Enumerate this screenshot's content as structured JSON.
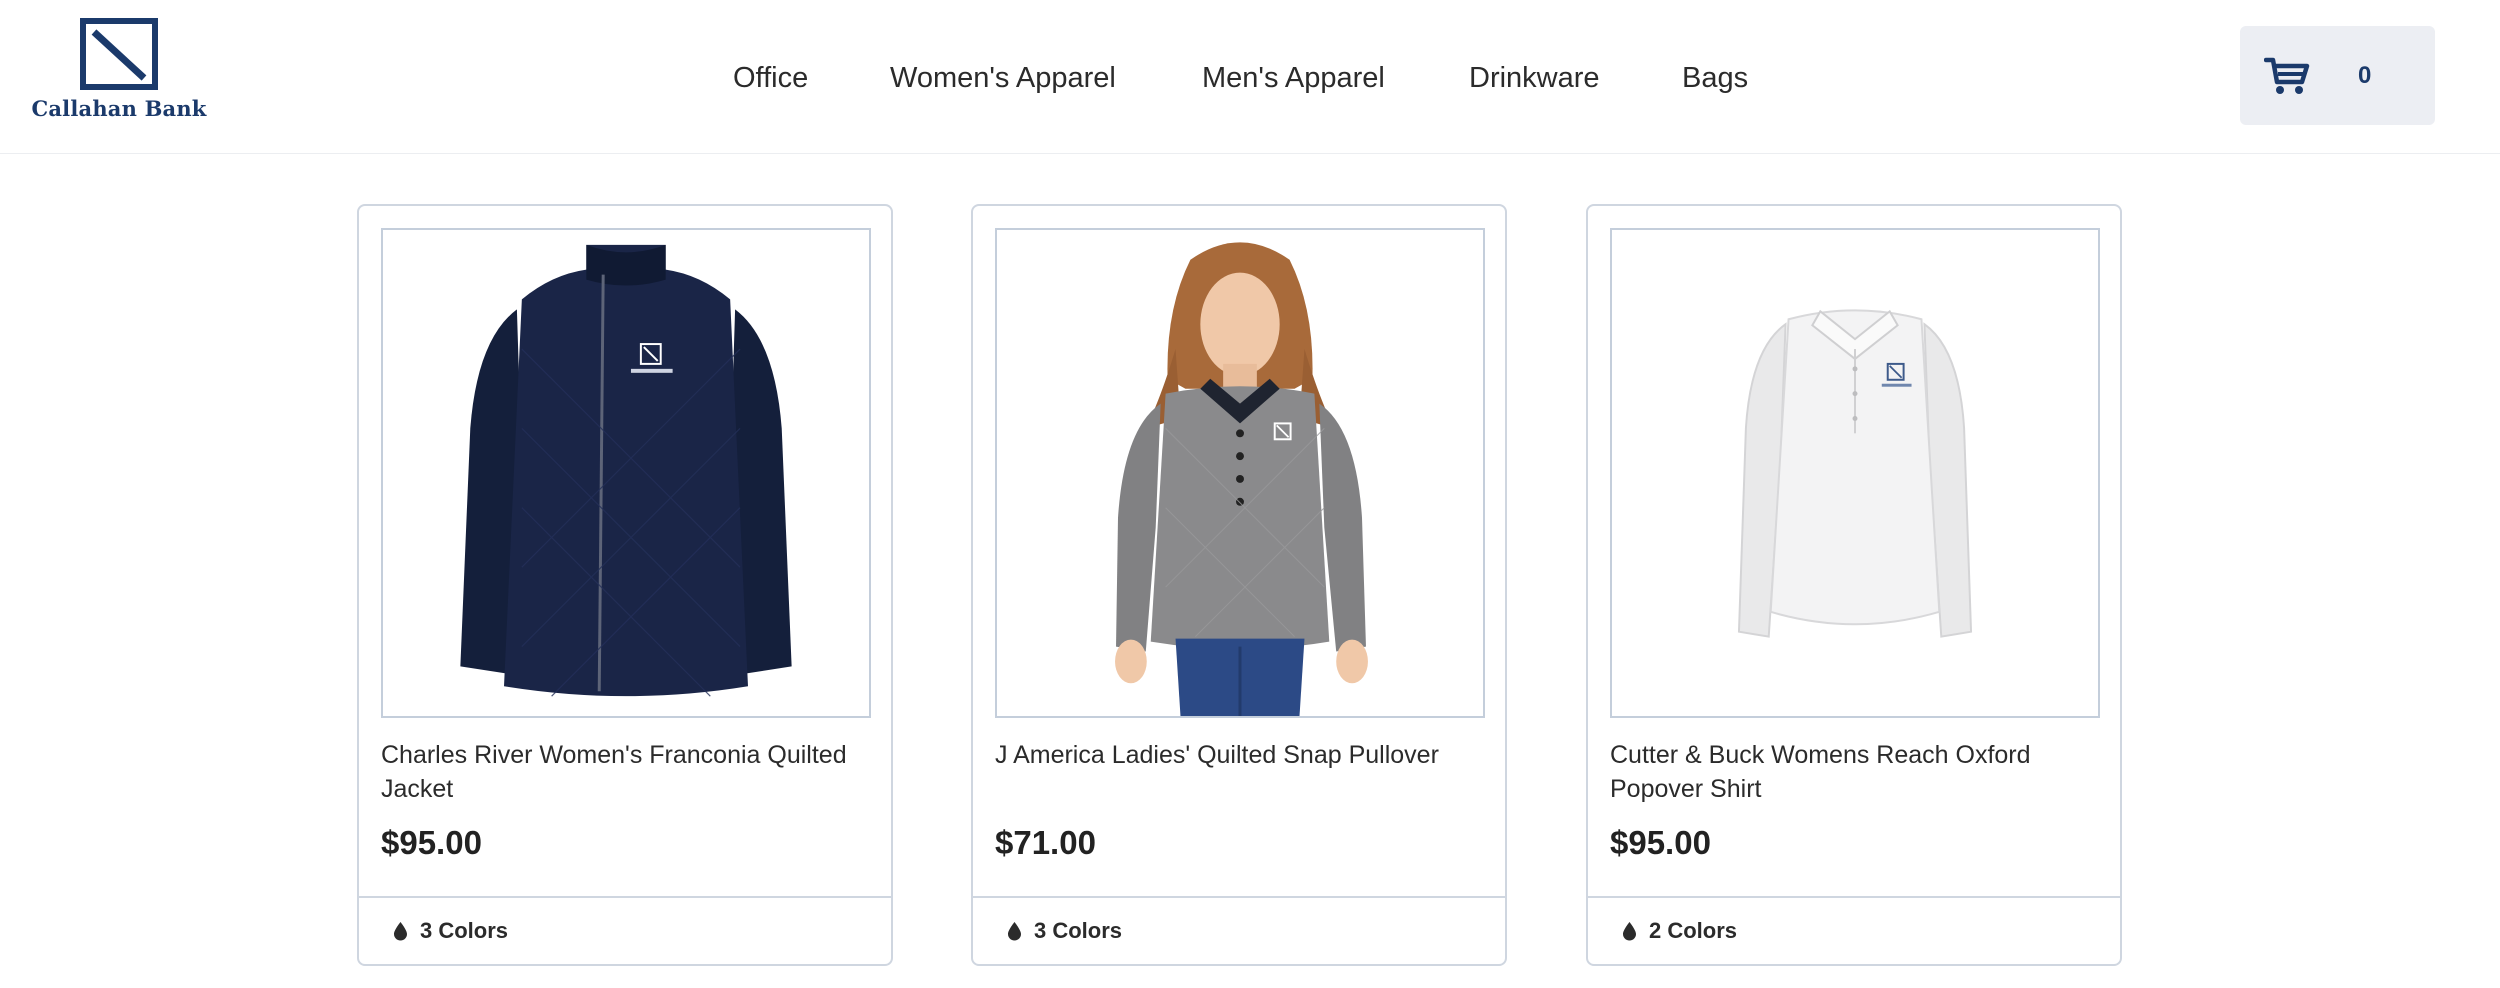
{
  "brand": {
    "name": "Callahan Bank",
    "color": "#1b3a6b"
  },
  "nav": {
    "items": [
      {
        "label": "Office"
      },
      {
        "label": "Women's Apparel"
      },
      {
        "label": "Men's Apparel"
      },
      {
        "label": "Drinkware"
      },
      {
        "label": "Bags"
      }
    ]
  },
  "cart": {
    "icon": "shopping-cart-icon",
    "count": "0"
  },
  "products": [
    {
      "title": "Charles River Women's Franconia Quilted Jacket",
      "price": "$95.00",
      "colors": "3 Colors",
      "image": "navy quilted full-zip jacket",
      "garment_color": "#141f3b"
    },
    {
      "title": "J America Ladies' Quilted Snap Pullover",
      "price": "$71.00",
      "colors": "3 Colors",
      "image": "woman wearing grey quilted snap pullover",
      "garment_color": "#7f7f81"
    },
    {
      "title": "Cutter & Buck Womens Reach Oxford Popover Shirt",
      "price": "$95.00",
      "colors": "2 Colors",
      "image": "white long-sleeve popover shirt",
      "garment_color": "#f1f1f1"
    }
  ]
}
